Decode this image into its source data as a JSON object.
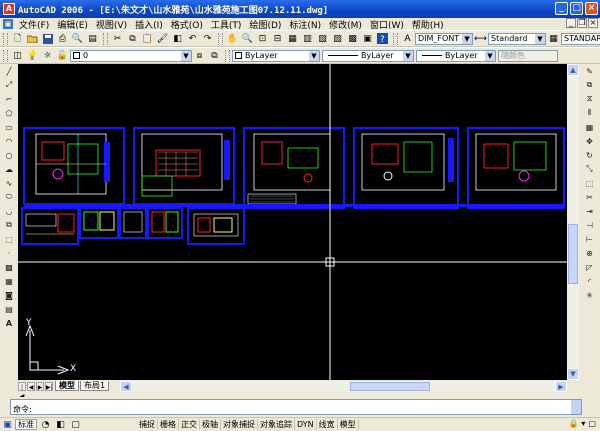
{
  "window": {
    "app_icon": "autocad-app-icon",
    "title": "AutoCAD 2006 - [E:\\朱文才\\山水雅苑\\山水雅苑施工图07.12.11.dwg]",
    "buttons": {
      "minimize": "_",
      "maximize": "□",
      "close": "×"
    }
  },
  "menubar": {
    "items": [
      "文件(F)",
      "编辑(E)",
      "视图(V)",
      "插入(I)",
      "格式(O)",
      "工具(T)",
      "绘图(D)",
      "标注(N)",
      "修改(M)",
      "窗口(W)",
      "帮助(H)"
    ],
    "doc_buttons": {
      "minimize": "_",
      "restore": "❐",
      "close": "×"
    }
  },
  "toolbar1": {
    "text_style": "DIM_FONT",
    "dim_style": "Standard",
    "table_style": "STANDARD"
  },
  "toolbar2": {
    "layer": "0",
    "color": "ByLayer",
    "linetype": "ByLayer",
    "lineweight": "ByLayer",
    "plot_style": "随颜色"
  },
  "canvas": {
    "background": "#000000",
    "ucs": {
      "x_label": "X",
      "y_label": "Y"
    }
  },
  "layout_tabs": [
    "模型",
    "布局1"
  ],
  "nav_buttons": [
    "|◀",
    "◀",
    "▶",
    "▶|"
  ],
  "command": {
    "prompt": "命令:"
  },
  "statusbar": {
    "coords": "标准",
    "toggles": [
      "捕捉",
      "栅格",
      "正交",
      "极轴",
      "对象捕捉",
      "对象追踪",
      "DYN",
      "线宽",
      "模型"
    ]
  }
}
